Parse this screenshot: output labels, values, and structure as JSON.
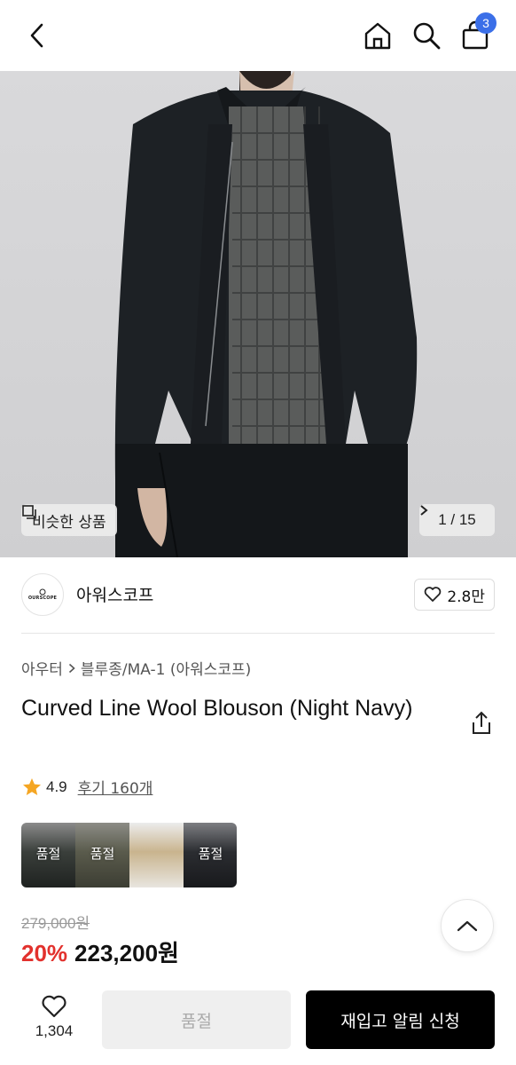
{
  "header": {
    "cart_count": "3"
  },
  "hero": {
    "similar_label": "비슷한 상품",
    "page_current": "1",
    "page_total": "15",
    "page_text": "1 / 15"
  },
  "brand": {
    "logo_text": "OURSCOPE",
    "name": "아워스코프",
    "likes": "2.8만"
  },
  "product": {
    "breadcrumb_1": "아우터",
    "breadcrumb_2": "블루종/MA-1 (아워스코프)",
    "title": "Curved Line Wool Blouson (Night Navy)",
    "rating": "4.9",
    "reviews": "후기 160개",
    "swatches": [
      {
        "label": "품절",
        "color": "#3a3f3b"
      },
      {
        "label": "품절",
        "color": "#5a5b4c"
      },
      {
        "label": "",
        "color": "#c9b48e"
      },
      {
        "label": "품절",
        "color": "#2b2d31"
      }
    ],
    "original_price": "279,000원",
    "discount": "20%",
    "price": "223,200원"
  },
  "bottom_bar": {
    "wish_count": "1,304",
    "soldout_label": "품절",
    "restock_label": "재입고 알림 신청"
  },
  "colors": {
    "accent_blue": "#3b6fe8",
    "discount_red": "#e2312d",
    "star": "#f5a623"
  }
}
